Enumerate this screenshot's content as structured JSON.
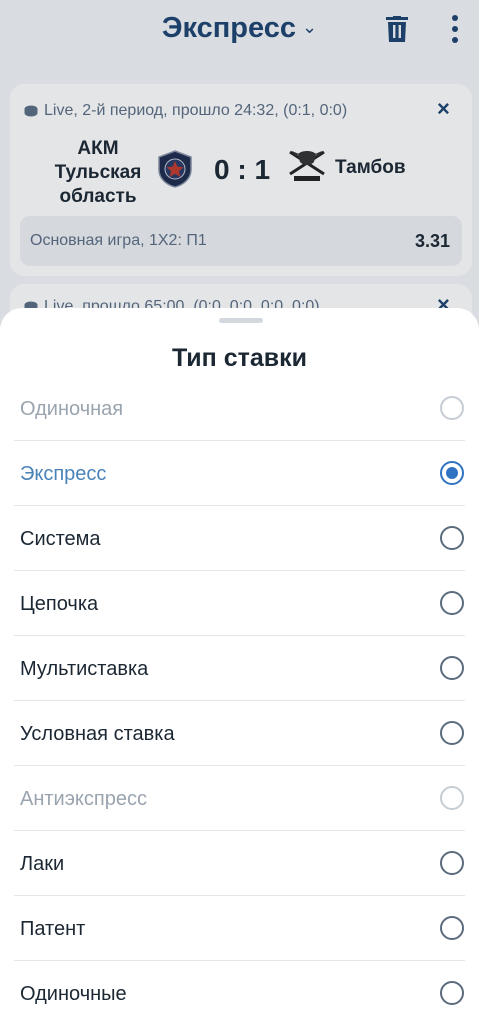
{
  "header": {
    "title": "Экспресс",
    "chevron": "⌄"
  },
  "icons": {
    "trash": "trash-icon",
    "more": "more-vertical-icon",
    "close": "close-icon",
    "puck": "hockey-puck-icon"
  },
  "event": {
    "live_info": "Live, 2-й период, прошло 24:32, (0:1, 0:0)",
    "team1": "АКМ Тульская область",
    "team2": "Тамбов",
    "score": "0 : 1",
    "bet_label": "Основная игра, 1Х2: П1",
    "odd": "3.31",
    "close": "×"
  },
  "event2": {
    "live_info": "Live, прошло 65:00, (0:0, 0:0, 0:0, 0:0)",
    "close": "×"
  },
  "sheet": {
    "title": "Тип ставки",
    "options": [
      {
        "label": "Одиночная",
        "state": "disabled"
      },
      {
        "label": "Экспресс",
        "state": "selected"
      },
      {
        "label": "Система",
        "state": "normal"
      },
      {
        "label": "Цепочка",
        "state": "normal"
      },
      {
        "label": "Мультиставка",
        "state": "normal"
      },
      {
        "label": "Условная ставка",
        "state": "normal"
      },
      {
        "label": "Антиэкспресс",
        "state": "disabled"
      },
      {
        "label": "Лаки",
        "state": "normal"
      },
      {
        "label": "Патент",
        "state": "normal"
      },
      {
        "label": "Одиночные",
        "state": "normal"
      }
    ]
  },
  "colors": {
    "brand_navy": "#1c4470",
    "selected_blue": "#2f73c2",
    "disabled_gray": "#9aa4af"
  }
}
